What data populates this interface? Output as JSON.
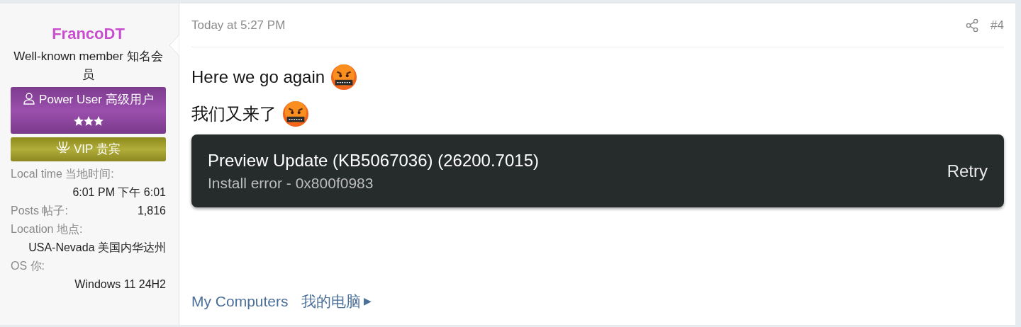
{
  "user": {
    "name": "FrancoDT",
    "title": "Well-known member  知名会员",
    "banners": [
      {
        "kind": "power",
        "label": "Power User  高级用户",
        "stars": 3
      },
      {
        "kind": "vip",
        "label": "VIP  贵宾"
      }
    ],
    "info": [
      {
        "kind": "stacked",
        "label": "Local time  当地时间:",
        "value": "6:01 PM  下午 6:01"
      },
      {
        "kind": "inline",
        "label": "Posts  帖子:",
        "value": "1,816"
      },
      {
        "kind": "stacked",
        "label": "Location  地点:",
        "value": "USA-Nevada  美国内华达州"
      },
      {
        "kind": "stacked",
        "label": "OS  你:",
        "value": "Windows 11 24H2"
      }
    ]
  },
  "post": {
    "date": "Today at 5:27 PM",
    "number": "#4",
    "lines": [
      "Here we go again",
      "我们又来了"
    ],
    "toast": {
      "title": "Preview Update (KB5067036) (26200.7015)",
      "subtitle": "Install error - 0x800f0983",
      "action": "Retry"
    },
    "signature": {
      "link": "My Computers",
      "link_cn": "我的电脑",
      "caret": "▶"
    }
  }
}
